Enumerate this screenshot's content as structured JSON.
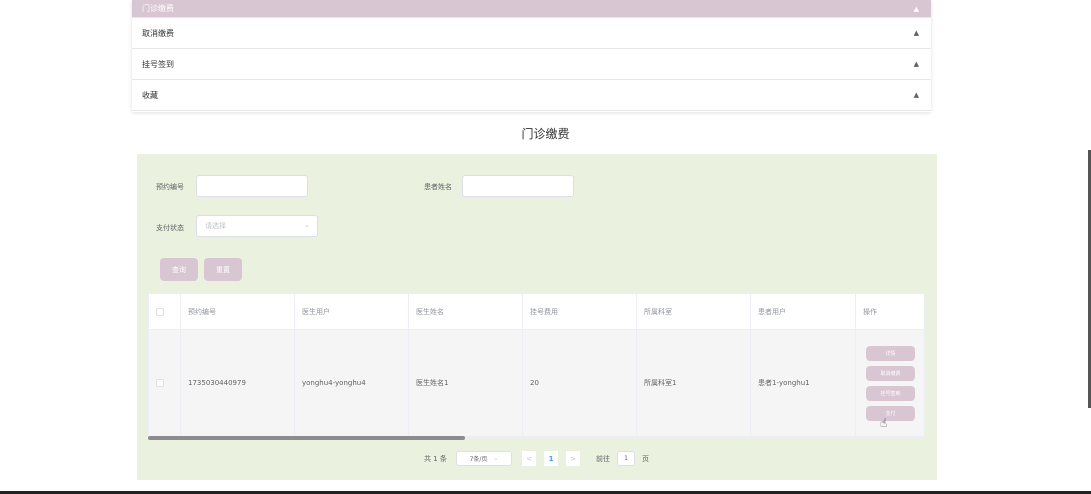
{
  "menu": {
    "items": [
      {
        "label": "门诊缴费"
      },
      {
        "label": "取消缴费"
      },
      {
        "label": "挂号签到"
      },
      {
        "label": "收藏"
      }
    ],
    "icon": "▲"
  },
  "page_title": "门诊缴费",
  "filters": {
    "appointment_no_label": "预约编号",
    "patient_name_label": "患者姓名",
    "pay_status_label": "支付状态",
    "pay_status_placeholder": "请选择",
    "chevron": "⌄"
  },
  "actions": {
    "search": "查询",
    "reset": "重置"
  },
  "table": {
    "headers": [
      "预约编号",
      "医生用户",
      "医生姓名",
      "挂号费用",
      "所属科室",
      "患者用户",
      "操作"
    ],
    "rows": [
      {
        "appointment_no": "1735030440979",
        "doctor_user": "yonghu4-yonghu4",
        "doctor_name": "医生姓名1",
        "fee": "20",
        "department": "所属科室1",
        "patient_user": "患者1-yonghu1",
        "ops": [
          "详情",
          "取消缴费",
          "挂号签到",
          "支付"
        ]
      }
    ]
  },
  "pagination": {
    "total": "共 1 条",
    "page_size": "7条/页",
    "prev": "<",
    "current_page": "1",
    "next": ">",
    "goto_prefix": "前往",
    "goto_value": "1",
    "goto_suffix": "页"
  },
  "colors": {
    "accent": "#d8c6d2",
    "panel": "#eaf1df"
  }
}
